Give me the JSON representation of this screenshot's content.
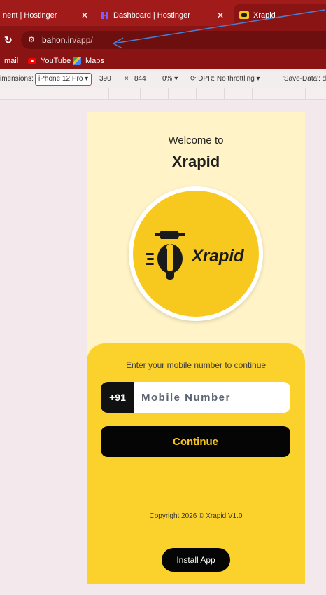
{
  "browser": {
    "tabs": [
      {
        "label": "nent | Hostinger"
      },
      {
        "label": "Dashboard | Hostinger"
      },
      {
        "label": "Xrapid",
        "active": true
      }
    ],
    "url": {
      "domain": "bahon.in",
      "path": "/app/"
    },
    "bookmarks": [
      {
        "label": "mail"
      },
      {
        "label": "YouTube"
      },
      {
        "label": "Maps"
      }
    ]
  },
  "devtools": {
    "dimensions_label": "imensions:",
    "device": "iPhone 12 Pro",
    "width": "390",
    "times": "×",
    "height": "844",
    "zoom": "0%",
    "dpr": "DPR: No throttling",
    "save_data": "'Save-Data': de"
  },
  "app": {
    "welcome": "Welcome to",
    "brand": "Xrapid",
    "logo_text": "Xrapid",
    "prompt": "Enter your mobile number to continue",
    "country_code": "+91",
    "mobile_placeholder": "Mobile Number",
    "continue_label": "Continue",
    "copyright": "Copyright 2026 © Xrapid V1.0",
    "install_label": "Install App"
  },
  "colors": {
    "chrome_red": "#a21b1b",
    "brand_yellow": "#f7c81e",
    "panel_yellow": "#fbd12c",
    "cream": "#fff3c7",
    "annotation_blue": "#4a7fd4"
  }
}
